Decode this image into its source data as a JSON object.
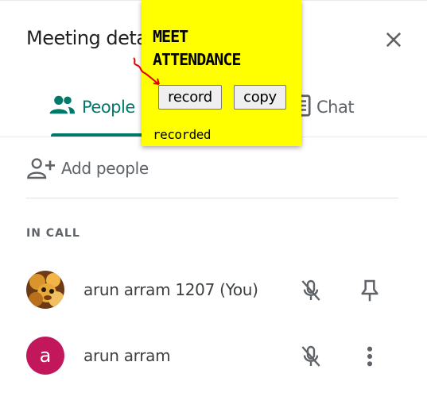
{
  "panel": {
    "title": "Meeting details",
    "tabs": [
      {
        "label": "People",
        "icon": "people-icon",
        "selected": true
      },
      {
        "label": "Chat",
        "icon": "chat-icon",
        "selected": false
      }
    ],
    "add_people_label": "Add people",
    "section_label": "IN CALL",
    "participants": [
      {
        "name": "arun arram 1207 (You)",
        "avatar": "photo",
        "mic": "muted",
        "action": "pin-icon"
      },
      {
        "name": "arun arram",
        "avatar_letter": "a",
        "mic": "muted",
        "action": "more-vert-icon"
      }
    ],
    "accent_color": "#00796b"
  },
  "extension": {
    "title_line1": "MEET",
    "title_line2": "ATTENDANCE",
    "record_label": "record",
    "copy_label": "copy",
    "status_text": "recorded",
    "background_color": "#ffff00"
  }
}
